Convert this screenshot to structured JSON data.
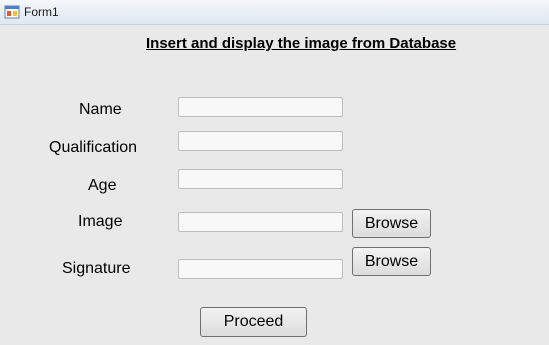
{
  "window": {
    "title": "Form1",
    "icon": "windows-form-icon"
  },
  "form": {
    "heading": "Insert and display the image from Database",
    "fields": {
      "name": {
        "label": "Name",
        "value": "",
        "placeholder": ""
      },
      "qualification": {
        "label": "Qualification",
        "value": "",
        "placeholder": ""
      },
      "age": {
        "label": "Age",
        "value": "",
        "placeholder": ""
      },
      "image": {
        "label": "Image",
        "value": "",
        "placeholder": "",
        "browse_label": "Browse"
      },
      "signature": {
        "label": "Signature",
        "value": "",
        "placeholder": "",
        "browse_label": "Browse"
      }
    },
    "proceed_label": "Proceed"
  }
}
